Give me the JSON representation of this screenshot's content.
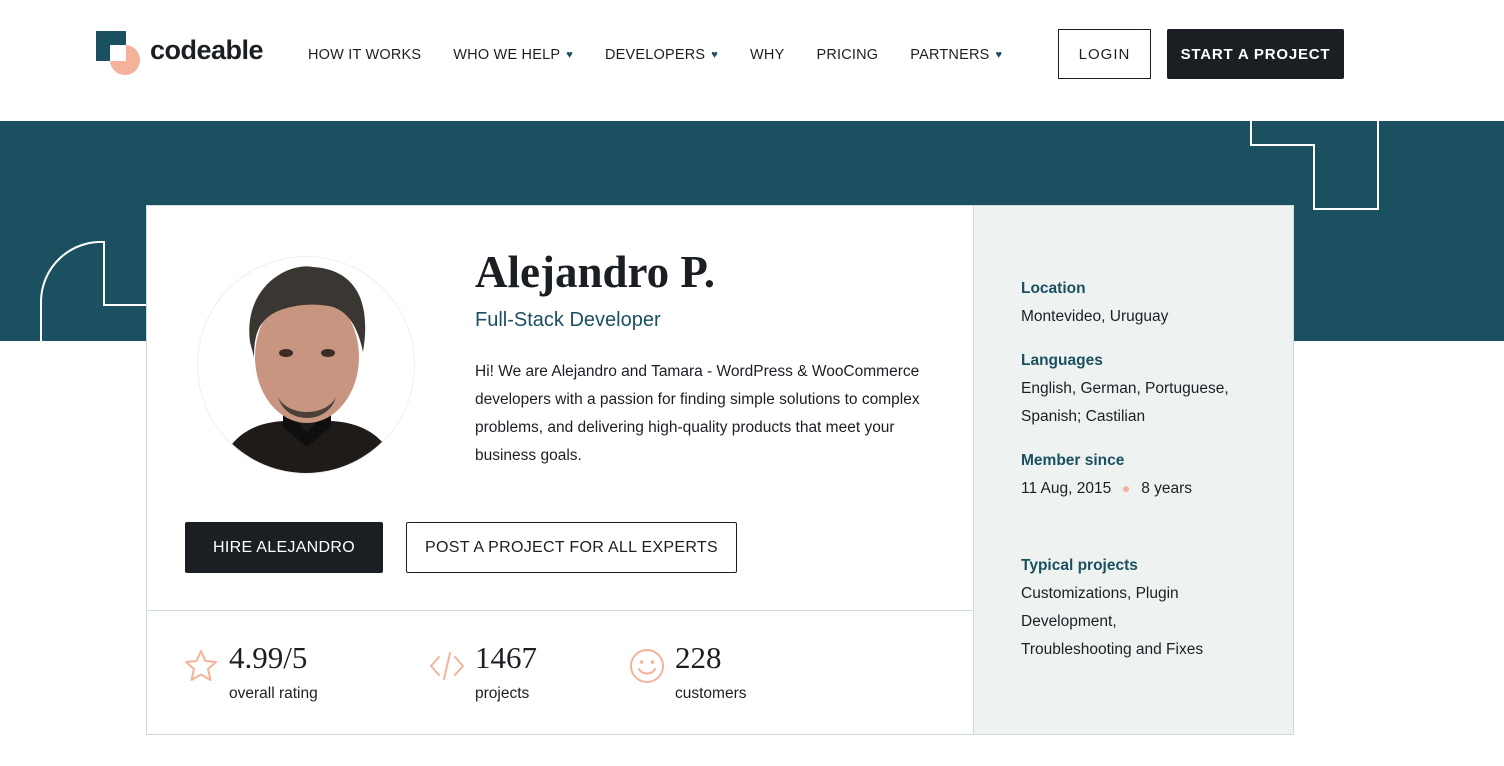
{
  "brand": {
    "name": "codeable"
  },
  "nav": {
    "items": [
      {
        "label": "HOW IT WORKS",
        "has_dropdown": false
      },
      {
        "label": "WHO WE HELP",
        "has_dropdown": true
      },
      {
        "label": "DEVELOPERS",
        "has_dropdown": true
      },
      {
        "label": "WHY",
        "has_dropdown": false
      },
      {
        "label": "PRICING",
        "has_dropdown": false
      },
      {
        "label": "PARTNERS",
        "has_dropdown": true
      }
    ],
    "login_label": "LOGIN",
    "start_label": "START A PROJECT"
  },
  "profile": {
    "name": "Alejandro P.",
    "role": "Full-Stack Developer",
    "bio": "Hi! We are Alejandro and Tamara - WordPress & WooCommerce developers with a passion for finding simple solutions to complex problems, and delivering high-quality products that meet your business goals.",
    "hire_label": "HIRE ALEJANDRO",
    "post_label": "POST A PROJECT FOR ALL EXPERTS"
  },
  "stats": [
    {
      "value": "4.99/5",
      "label": "overall rating",
      "icon": "star-icon"
    },
    {
      "value": "1467",
      "label": "projects",
      "icon": "code-icon"
    },
    {
      "value": "228",
      "label": "customers",
      "icon": "smiley-icon"
    }
  ],
  "sidebar": {
    "location_label": "Location",
    "location_value": "Montevideo, Uruguay",
    "languages_label": "Languages",
    "languages_value": "English, German, Portuguese, Spanish; Castilian",
    "member_label": "Member since",
    "member_date": "11 Aug, 2015",
    "member_years": "8 years",
    "projects_label": "Typical projects",
    "projects_value": "Customizations, Plugin Development, Troubleshooting and Fixes"
  },
  "colors": {
    "brand_teal": "#1a5060",
    "accent_peach": "#f5b29a",
    "dark": "#1b1f24",
    "side_bg": "#eef3f2"
  }
}
